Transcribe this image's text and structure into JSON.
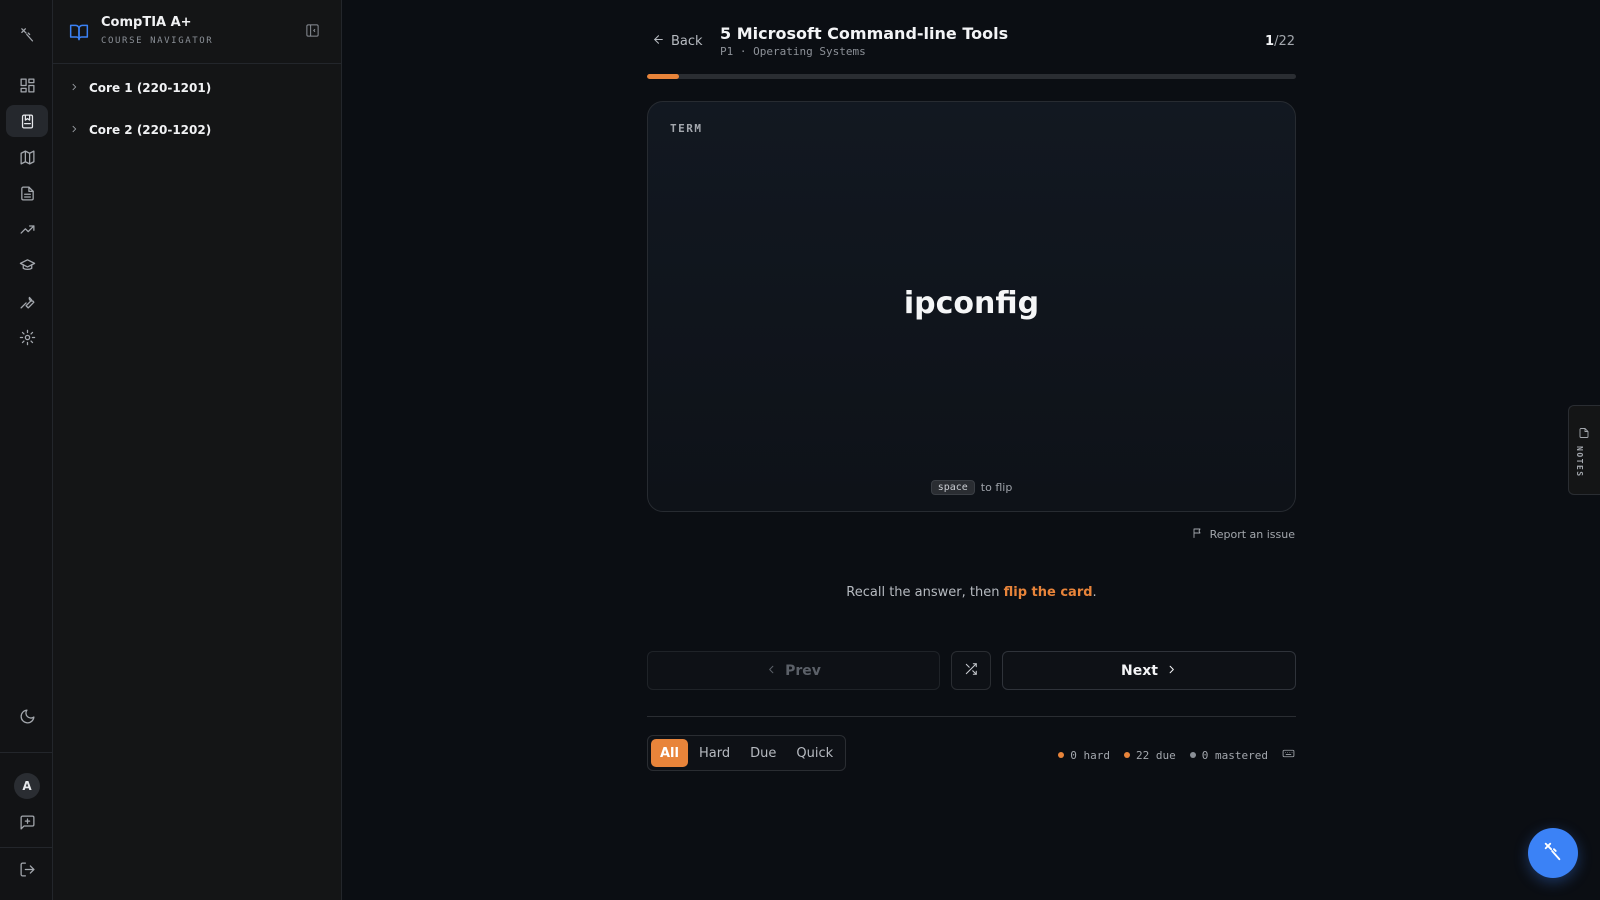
{
  "navigator": {
    "title": "CompTIA A+",
    "subtitle": "COURSE NAVIGATOR",
    "items": [
      {
        "label": "Core 1 (220-1201)"
      },
      {
        "label": "Core 2 (220-1202)"
      }
    ]
  },
  "header": {
    "back_label": "Back",
    "title": "5 Microsoft Command-line Tools",
    "subtitle": "P1 · Operating Systems",
    "counter_current": "1",
    "counter_total": "/22"
  },
  "progress": {
    "fraction": 0.05
  },
  "card": {
    "label": "TERM",
    "term": "ipconfig",
    "hint_key": "space",
    "hint_text": "to flip"
  },
  "report_label": "Report an issue",
  "recall": {
    "prefix": "Recall the answer, then ",
    "link": "flip the card",
    "suffix": "."
  },
  "controls": {
    "prev_label": "Prev",
    "next_label": "Next"
  },
  "filters": [
    {
      "label": "All",
      "active": true
    },
    {
      "label": "Hard",
      "active": false
    },
    {
      "label": "Due",
      "active": false
    },
    {
      "label": "Quick",
      "active": false
    }
  ],
  "stats": {
    "hard": "0 hard",
    "due": "22 due",
    "mastered": "0 mastered"
  },
  "notes_tab_label": "NOTES",
  "colors": {
    "accent": "#e8843a",
    "brand_blue": "#3b82f6",
    "mastered_dot": "#8a8f96"
  },
  "icons": {
    "rail": [
      "logo-icon",
      "dashboard-icon",
      "flashcards-icon",
      "map-icon",
      "notes-icon",
      "trending-icon",
      "graduation-cap-icon",
      "wrench-icon",
      "settings-icon",
      "moon-icon",
      "feedback-icon",
      "logout-icon"
    ]
  },
  "avatar_initial": "A"
}
